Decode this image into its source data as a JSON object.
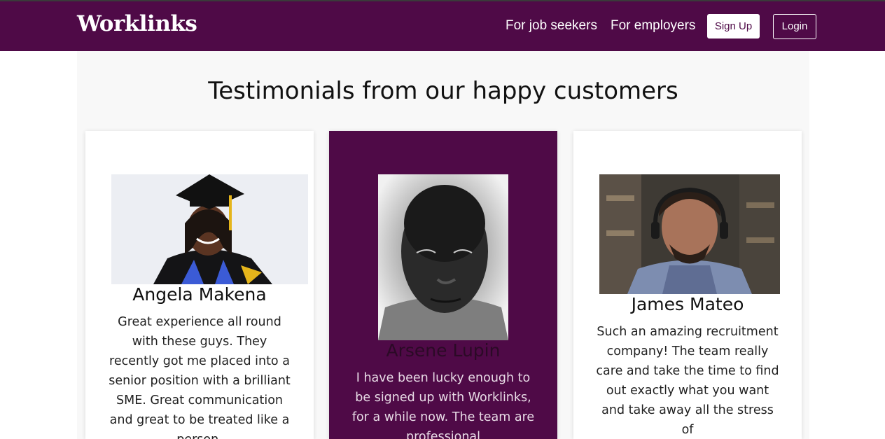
{
  "header": {
    "brand": "Worklinks",
    "nav": {
      "job_seekers": "For job seekers",
      "employers": "For employers",
      "signup": "Sign Up",
      "login": "Login"
    }
  },
  "testimonials": {
    "title": "Testimonials from our happy customers",
    "cards": [
      {
        "name": "Angela Makena",
        "quote": "Great experience all round with these guys. They recently got me placed into a senior position with a brilliant SME. Great communication and great to be treated like a person."
      },
      {
        "name": "Arsene Lupin",
        "quote": "I have been lucky enough to be signed up with Worklinks, for a while now. The team are professional"
      },
      {
        "name": "James Mateo",
        "quote": "Such an amazing recruitment company! The team really care and take the time to find out exactly what you want and take away all the stress of"
      }
    ]
  },
  "colors": {
    "brand_purple": "#4f0a47",
    "section_bg": "#f8f8f8"
  }
}
